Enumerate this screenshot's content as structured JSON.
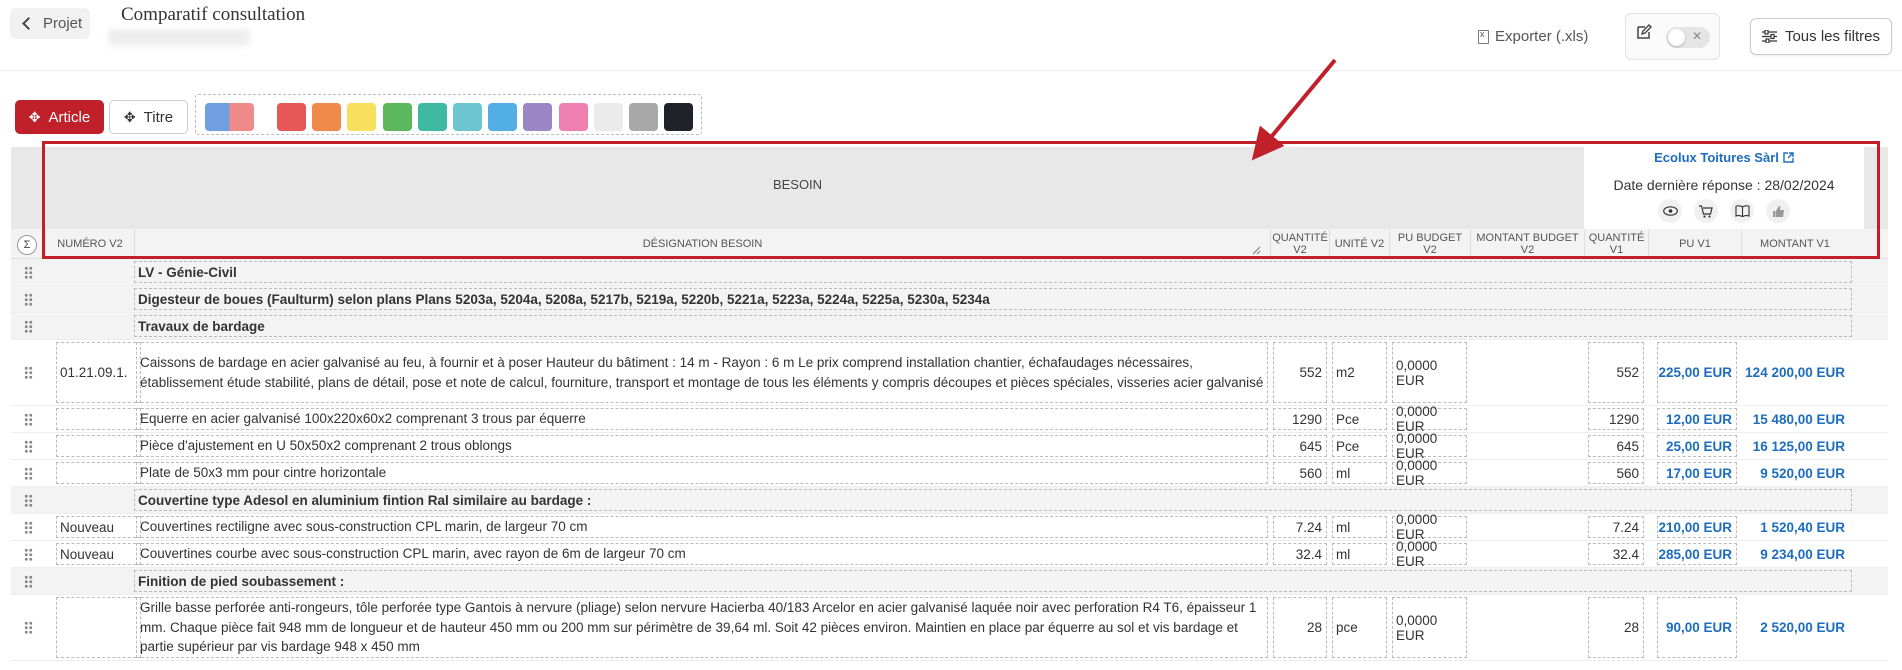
{
  "topbar": {
    "back_label": "Projet",
    "title": "Comparatif consultation",
    "export_label": "Exporter (.xls)",
    "filters_label": "Tous les filtres"
  },
  "toolbar": {
    "article_label": "Article",
    "titre_label": "Titre",
    "swatches": [
      "#e85757",
      "#f08a4b",
      "#f6e05e",
      "#5cb85c",
      "#3fb8a4",
      "#6cc5cf",
      "#54aee6",
      "#9b87c5",
      "#ee7fb0",
      "#ebebeb",
      "#a8a8a8",
      "#1f2329"
    ]
  },
  "header": {
    "besoin": "BESOIN",
    "supplier_name": "Ecolux Toitures Sàrl",
    "supplier_date": "Date dernière réponse : 28/02/2024",
    "columns": {
      "sigma": "Σ",
      "numero": "NUMÉRO V2",
      "designation": "DÉSIGNATION BESOIN",
      "quantite_v2": "QUANTITÉ V2",
      "unite_v2": "UNITÉ V2",
      "pu_budget_v2": "PU BUDGET V2",
      "montant_budget_v2": "MONTANT BUDGET V2",
      "quantite_v1": "QUANTITÉ V1",
      "pu_v1": "PU V1",
      "montant_v1": "MONTANT V1"
    }
  },
  "rows": [
    {
      "type": "section",
      "label": "LV - Génie-Civil"
    },
    {
      "type": "section",
      "label": "Digesteur de boues (Faulturm) selon plans Plans 5203a, 5204a, 5208a, 5217b, 5219a, 5220b, 5221a, 5223a, 5224a, 5225a, 5230a, 5234a"
    },
    {
      "type": "section",
      "label": "Travaux de bardage"
    },
    {
      "type": "item",
      "numero": "01.21.09.1.",
      "designation": "Caissons de bardage en acier galvanisé au feu, à fournir et à poser Hauteur du bâtiment : 14 m - Rayon : 6 m  Le prix comprend installation chantier, échafaudages nécessaires, établissement étude stabilité, plans de détail, pose et note de calcul, fourniture, transport et montage de tous les éléments y compris découpes et pièces spéciales, visseries acier galvanisé",
      "quantite_v2": "552",
      "unite_v2": "m2",
      "pu_budget_v2": "0,0000 EUR",
      "quantite_v1": "552",
      "pu_v1": "225,00 EUR",
      "montant_v1": "124 200,00 EUR"
    },
    {
      "type": "item",
      "numero": "",
      "designation": "Equerre en acier galvanisé 100x220x60x2 comprenant 3 trous par équerre",
      "quantite_v2": "1290",
      "unite_v2": "Pce",
      "pu_budget_v2": "0,0000 EUR",
      "quantite_v1": "1290",
      "pu_v1": "12,00 EUR",
      "montant_v1": "15 480,00 EUR"
    },
    {
      "type": "item",
      "numero": "",
      "designation": "Pièce d'ajustement en U 50x50x2 comprenant 2 trous oblongs",
      "quantite_v2": "645",
      "unite_v2": "Pce",
      "pu_budget_v2": "0,0000 EUR",
      "quantite_v1": "645",
      "pu_v1": "25,00 EUR",
      "montant_v1": "16 125,00 EUR"
    },
    {
      "type": "item",
      "numero": "",
      "designation": "Plate de 50x3 mm pour cintre horizontale",
      "quantite_v2": "560",
      "unite_v2": "ml",
      "pu_budget_v2": "0,0000 EUR",
      "quantite_v1": "560",
      "pu_v1": "17,00 EUR",
      "montant_v1": "9 520,00 EUR"
    },
    {
      "type": "section",
      "label": "Couvertine type Adesol en aluminium fintion Ral similaire au bardage :"
    },
    {
      "type": "item",
      "numero": "Nouveau",
      "designation": "Couvertines rectiligne avec sous-construction CPL marin, de largeur 70 cm",
      "quantite_v2": "7.24",
      "unite_v2": "ml",
      "pu_budget_v2": "0,0000 EUR",
      "quantite_v1": "7.24",
      "pu_v1": "210,00 EUR",
      "montant_v1": "1 520,40 EUR"
    },
    {
      "type": "item",
      "numero": "Nouveau",
      "designation": "Couvertines courbe avec sous-construction CPL marin, avec rayon de 6m de largeur 70 cm",
      "quantite_v2": "32.4",
      "unite_v2": "ml",
      "pu_budget_v2": "0,0000 EUR",
      "quantite_v1": "32.4",
      "pu_v1": "285,00 EUR",
      "montant_v1": "9 234,00 EUR"
    },
    {
      "type": "section",
      "label": "Finition de pied soubassement :"
    },
    {
      "type": "item",
      "numero": "",
      "designation": "Grille basse perforée anti-rongeurs, tôle perforée type Gantois à nervure (pliage) selon nervure Hacierba 40/183 Arcelor en acier galvanisé laquée noir avec perforation R4 T6, épaisseur 1 mm.  Chaque pièce fait 948 mm de longueur et de hauteur 450 mm ou 200 mm sur périmètre de 39,64 ml. Soit 42 pièces environ.  Maintien en place par équerre au sol et vis bardage et partie supérieur par vis bardage 948 x 450 mm",
      "quantite_v2": "28",
      "unite_v2": "pce",
      "pu_budget_v2": "0,0000 EUR",
      "quantite_v1": "28",
      "pu_v1": "90,00 EUR",
      "montant_v1": "2 520,00 EUR"
    }
  ]
}
